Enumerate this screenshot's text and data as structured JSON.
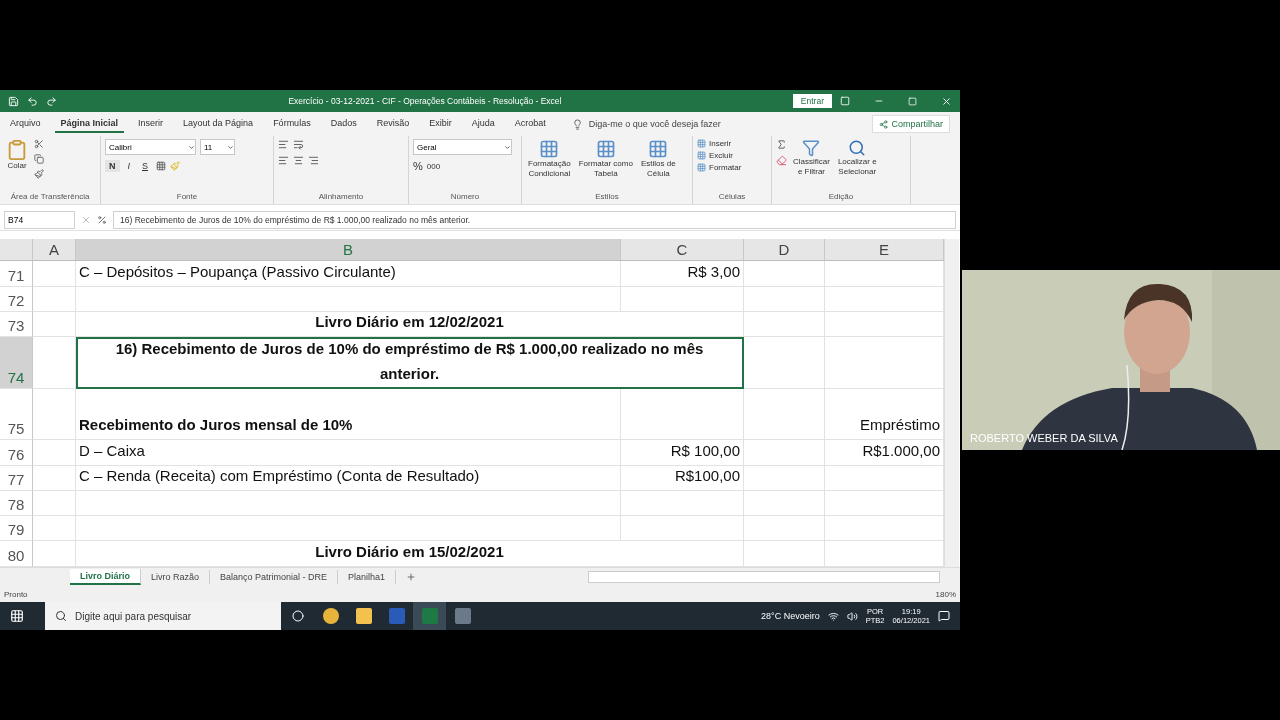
{
  "window": {
    "title": "Exercício - 03-12-2021 - CIF - Operações Contábeis - Resolução - Excel",
    "sign_in": "Entrar"
  },
  "ribbon_tabs": [
    {
      "label": "Arquivo",
      "selected": false
    },
    {
      "label": "Página Inicial",
      "selected": true
    },
    {
      "label": "Inserir",
      "selected": false
    },
    {
      "label": "Layout da Página",
      "selected": false
    },
    {
      "label": "Fórmulas",
      "selected": false
    },
    {
      "label": "Dados",
      "selected": false
    },
    {
      "label": "Revisão",
      "selected": false
    },
    {
      "label": "Exibir",
      "selected": false
    },
    {
      "label": "Ajuda",
      "selected": false
    },
    {
      "label": "Acrobat",
      "selected": false
    }
  ],
  "tell_me": {
    "placeholder": "Diga-me o que você deseja fazer"
  },
  "share": "Compartilhar",
  "ribbon": {
    "clipboard": {
      "paste": "Colar",
      "label": "Área de Transferência"
    },
    "font": {
      "name": "Calibri",
      "size": "11",
      "bold": "N",
      "italic": "I",
      "underline": "S",
      "label": "Fonte"
    },
    "alignment": {
      "label": "Alinhamento"
    },
    "number": {
      "format": "Geral",
      "percent": "%",
      "thousands": "000",
      "label": "Número"
    },
    "styles": {
      "commands": [
        {
          "lines": [
            "Formatação",
            "Condicional"
          ]
        },
        {
          "lines": [
            "Formatar como",
            "Tabela"
          ]
        },
        {
          "lines": [
            "Estilos de",
            "Célula"
          ]
        }
      ],
      "label": "Estilos"
    },
    "cells": {
      "commands": [
        "Inserir",
        "Excluir",
        "Formatar"
      ],
      "label": "Células"
    },
    "editing": {
      "commands": [
        {
          "lines": [
            "Classificar",
            "e Filtrar"
          ]
        },
        {
          "lines": [
            "Localizar e",
            "Selecionar"
          ]
        }
      ],
      "label": "Edição"
    }
  },
  "formula_bar": {
    "cell": "B74",
    "formula": "16) Recebimento de Juros de 10% do empréstimo de R$ 1.000,00 realizado no mês anterior."
  },
  "columns": [
    {
      "label": "A",
      "selected": false
    },
    {
      "label": "B",
      "selected": true
    },
    {
      "label": "C",
      "selected": false
    },
    {
      "label": "D",
      "selected": false
    },
    {
      "label": "E",
      "selected": false
    }
  ],
  "rows": [
    {
      "number": "71",
      "selected": false,
      "kind": "entry",
      "b": {
        "text": "C – Depósitos – Poupança (Passivo Circulante)",
        "bold": false
      },
      "c": "R$ 3,00"
    },
    {
      "number": "72",
      "selected": false,
      "kind": "entry"
    },
    {
      "number": "73",
      "selected": false,
      "kind": "heading",
      "title": "Livro Diário em 12/02/2021"
    },
    {
      "number": "74",
      "selected": true,
      "kind": "heading",
      "title": "16) Recebimento de Juros de 10% do empréstimo de R$ 1.000,00 realizado no mês anterior."
    },
    {
      "number": "75",
      "selected": false,
      "kind": "entry",
      "b": {
        "text": "Recebimento do Juros mensal de 10%",
        "bold": true
      },
      "e": "Empréstimo"
    },
    {
      "number": "76",
      "selected": false,
      "kind": "entry",
      "b": {
        "text": "D – Caixa",
        "bold": false
      },
      "c": "R$ 100,00",
      "e": "R$1.000,00"
    },
    {
      "number": "77",
      "selected": false,
      "kind": "entry",
      "b": {
        "text": "C – Renda (Receita) com Empréstimo (Conta de Resultado)",
        "bold": false
      },
      "c": "R$100,00"
    },
    {
      "number": "78",
      "selected": false,
      "kind": "entry"
    },
    {
      "number": "79",
      "selected": false,
      "kind": "entry"
    },
    {
      "number": "80",
      "selected": false,
      "kind": "heading",
      "title": "Livro Diário em 15/02/2021"
    }
  ],
  "sheets": [
    {
      "label": "Livro Diário",
      "selected": true
    },
    {
      "label": "Livro Razão",
      "selected": false
    },
    {
      "label": "Balanço Patrimonial - DRE",
      "selected": false
    },
    {
      "label": "Planilha1",
      "selected": false
    }
  ],
  "status": {
    "text": "Pronto",
    "zoom": "180%"
  },
  "taskbar": {
    "search_placeholder": "Digite aqui para pesquisar",
    "weather": "28°C  Nevoeiro",
    "language": "POR",
    "layout": "PTB2",
    "time": "19:19",
    "date": "06/12/2021"
  },
  "video": {
    "kind": "picture",
    "name": "ROBERTO WEBER DA SILVA"
  }
}
